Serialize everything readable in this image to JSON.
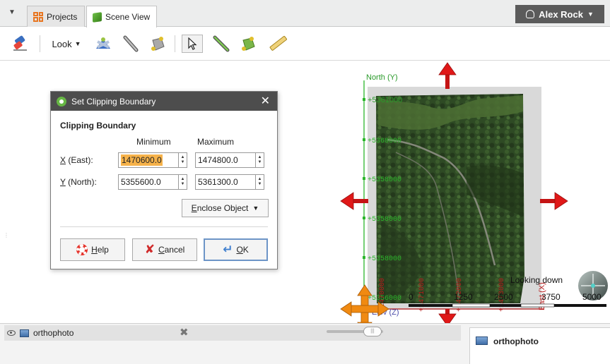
{
  "tabs": [
    {
      "label": "Projects"
    },
    {
      "label": "Scene View"
    }
  ],
  "user": {
    "name": "Alex Rock"
  },
  "toolbar": {
    "look_label": "Look"
  },
  "dialog": {
    "title": "Set Clipping Boundary",
    "section_title": "Clipping Boundary",
    "col_min": "Minimum",
    "col_max": "Maximum",
    "x_label_key": "X",
    "x_label_rest": " (East):",
    "y_label_key": "Y",
    "y_label_rest": " (North):",
    "x_min": "1470600.0",
    "x_max": "1474800.0",
    "y_min": "5355600.0",
    "y_max": "5361300.0",
    "enclose_key": "E",
    "enclose_rest": "nclose Object",
    "help_key": "H",
    "help_rest": "elp",
    "cancel_key": "C",
    "cancel_rest": "ancel",
    "ok_key": "O",
    "ok_rest": "K"
  },
  "scene": {
    "north_axis_label": "North (Y)",
    "north_tick_top": "+5361000",
    "east_axis_label": "East (X)",
    "elev_label": "Elev (Z)",
    "looking_label": "Looking down",
    "scale_labels": [
      "0",
      "1250",
      "2500",
      "3750",
      "5000"
    ]
  },
  "bottom": {
    "object_name": "orthophoto",
    "properties_title": "orthophoto"
  },
  "colors": {
    "arrow_red": "#d41818",
    "arrow_orange": "#f08a12",
    "axis_green": "#2bb52b",
    "axis_red": "#b81c1c",
    "title_bar": "#4d4d4d",
    "selection_highlight": "#f6b24a"
  }
}
